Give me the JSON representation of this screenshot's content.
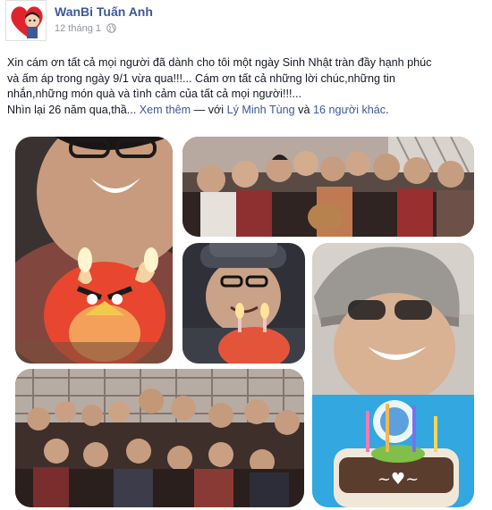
{
  "author": {
    "name": "WanBi Tuấn Anh"
  },
  "meta": {
    "date": "12 tháng 1",
    "privacy_icon": "globe-icon"
  },
  "post": {
    "line1": "Xin cám ơn tất cả mọi người đã dành cho tôi một ngày Sinh Nhật tràn đầy hạnh phúc",
    "line2": "và ấm áp trong ngày 9/1 vừa qua!!!... Cám ơn tất cả những lời chúc,những tin",
    "line3": "nhắn,những món quà và tình cảm của tất cả mọi người!!!...",
    "line4_prefix": "Nhìn lại 26 năm qua,thầ...",
    "see_more": "Xem thêm",
    "dash": " — với ",
    "tagged_person": "Lý Minh Tùng",
    "and": " và ",
    "others": "16 người khác",
    "end": "."
  },
  "photos": [
    {
      "name": "photo-birthday-cake-closeup"
    },
    {
      "name": "photo-group-friends"
    },
    {
      "name": "photo-hat-candles"
    },
    {
      "name": "photo-beanie-cake"
    },
    {
      "name": "photo-group-party"
    }
  ],
  "colors": {
    "link": "#3b5998",
    "meta": "#90949c",
    "text": "#141823"
  }
}
